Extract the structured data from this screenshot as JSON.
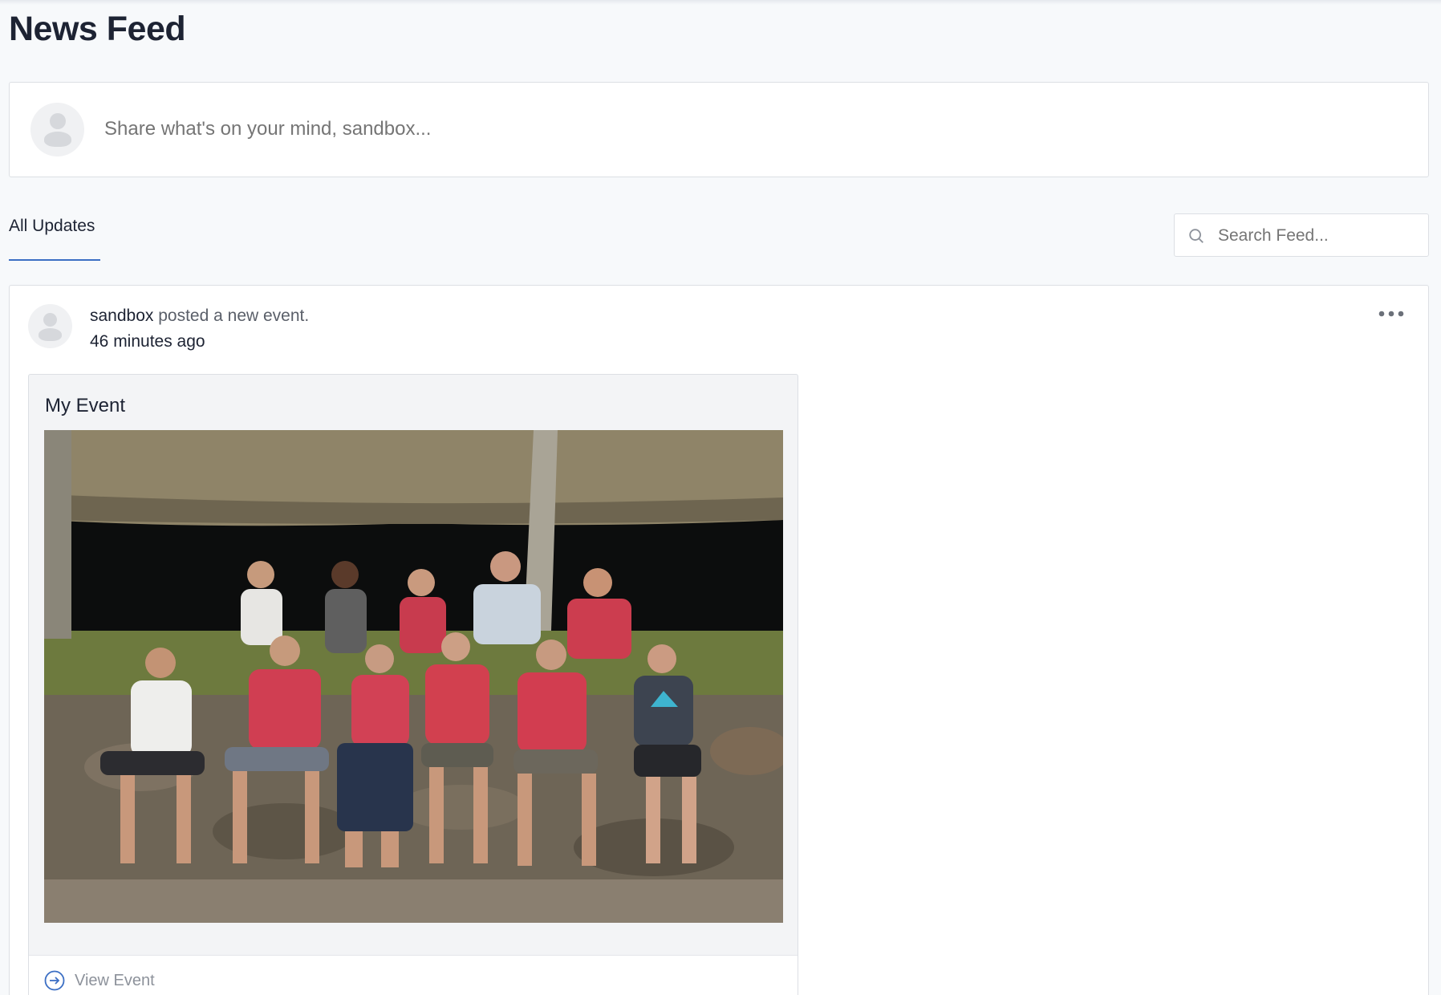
{
  "page": {
    "title": "News Feed"
  },
  "composer": {
    "placeholder": "Share what's on your mind, sandbox..."
  },
  "tabs": [
    {
      "label": "All Updates",
      "active": true
    }
  ],
  "search": {
    "placeholder": "Search Feed..."
  },
  "post": {
    "author": "sandbox",
    "action": " posted a new event.",
    "time": "46 minutes ago",
    "event": {
      "title": "My Event",
      "link_label": "View Event"
    }
  },
  "colors": {
    "accent": "#3c6fc4",
    "text": "#1d2333",
    "muted": "#8d929b",
    "background": "#f7f9fb"
  },
  "icons": [
    "avatar-placeholder",
    "search-icon",
    "more-horizontal-icon",
    "arrow-right-circle-icon"
  ]
}
